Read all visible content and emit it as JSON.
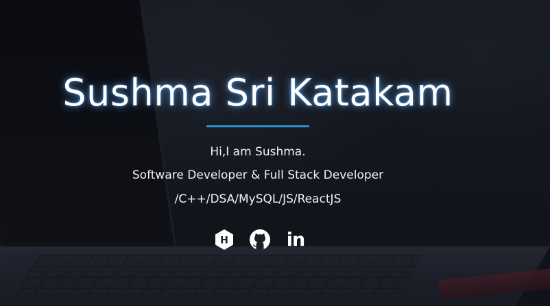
{
  "hero": {
    "name": "Sushma Sri Katakam",
    "greeting": "Hi,I am Sushma.",
    "role": "Software Developer & Full Stack Developer",
    "skills": "/C++/DSA/MySQL/JS/ReactJS",
    "accent_color": "#2a93d5"
  },
  "socials": [
    {
      "icon": "hackerrank-icon",
      "glyph": "H"
    },
    {
      "icon": "github-icon"
    },
    {
      "icon": "linkedin-icon",
      "glyph": "in"
    }
  ]
}
